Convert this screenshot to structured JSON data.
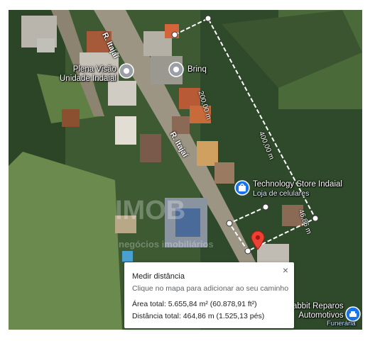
{
  "map": {
    "streets": {
      "upper": "R. Itajaí",
      "lower": "R. Itajaí"
    },
    "pois": {
      "plena_line1": "Plena Visão",
      "plena_line2": "Unidade Indaial",
      "brinq": "Brinq",
      "tech_line1": "Technology Store Indaial",
      "tech_line2": "Loja de celulares",
      "rabbit_line1": "abbit Reparos",
      "rabbit_line2": "Automotivos",
      "funeraria": "Funerária"
    },
    "segment_labels": {
      "seg_200": "200,00 m",
      "seg_400": "400,00 m",
      "seg_46": "46,86 m"
    },
    "watermark": {
      "brand": "IMOB",
      "sub": "negócios imobiliários"
    }
  },
  "measure_panel": {
    "title": "Medir distância",
    "hint": "Clique no mapa para adicionar ao seu caminho",
    "area": "Área total: 5.655,84 m² (60.878,91 ft²)",
    "distance": "Distância total: 464,86 m (1.525,13 pés)",
    "close": "×"
  },
  "colors": {
    "measure_line": "#ffffff",
    "pin": "#ea4335",
    "poi_icon": "#1a73e8",
    "poi_gray": "#9aa0a6"
  }
}
